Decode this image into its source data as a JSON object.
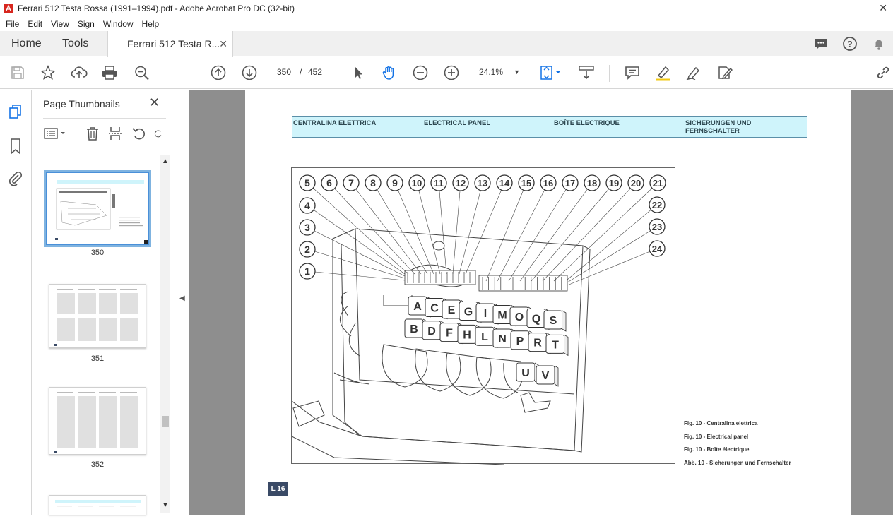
{
  "window": {
    "title": "Ferrari 512 Testa Rossa (1991–1994).pdf - Adobe Acrobat Pro DC (32-bit)"
  },
  "menu": [
    "File",
    "Edit",
    "View",
    "Sign",
    "Window",
    "Help"
  ],
  "tabs": {
    "home": "Home",
    "tools": "Tools",
    "document": "Ferrari 512 Testa R..."
  },
  "toolbar": {
    "current_page": "350",
    "page_separator": "/",
    "total_pages": "452",
    "zoom": "24.1%"
  },
  "thumbnails": {
    "title": "Page Thumbnails",
    "items": [
      {
        "label": "350",
        "selected": true
      },
      {
        "label": "351",
        "selected": false
      },
      {
        "label": "352",
        "selected": false
      }
    ]
  },
  "document": {
    "header": {
      "col1": "CENTRALINA ELETTRICA",
      "col2": "ELECTRICAL PANEL",
      "col3": "BOÎTE ELECTRIQUE",
      "col4_line1": "SICHERUNGEN UND",
      "col4_line2": "FERNSCHALTER"
    },
    "callouts_top": [
      "5",
      "6",
      "7",
      "8",
      "9",
      "10",
      "11",
      "12",
      "13",
      "14",
      "15",
      "16",
      "17",
      "18",
      "19",
      "20",
      "21"
    ],
    "callouts_left": [
      "4",
      "3",
      "2",
      "1"
    ],
    "callouts_right": [
      "22",
      "23",
      "24"
    ],
    "relay_row1": [
      "A",
      "C",
      "E",
      "G",
      "I",
      "M",
      "O",
      "Q",
      "S"
    ],
    "relay_row2": [
      "B",
      "D",
      "F",
      "H",
      "L",
      "N",
      "P",
      "R",
      "T"
    ],
    "relay_row3": [
      "U",
      "V"
    ],
    "captions": [
      "Fig. 10 -  Centralina elettrica",
      "Fig. 10 - Electrical panel",
      "Fig. 10 - Boîte électrique",
      "Abb. 10 - Sicherungen und Fernschalter"
    ],
    "page_label": "L 16"
  },
  "colors": {
    "header_band": "#cff4fb",
    "doc_background": "#8e8e8e",
    "selection_outline": "#7fb3e0",
    "acrobat_red": "#d7261e"
  }
}
